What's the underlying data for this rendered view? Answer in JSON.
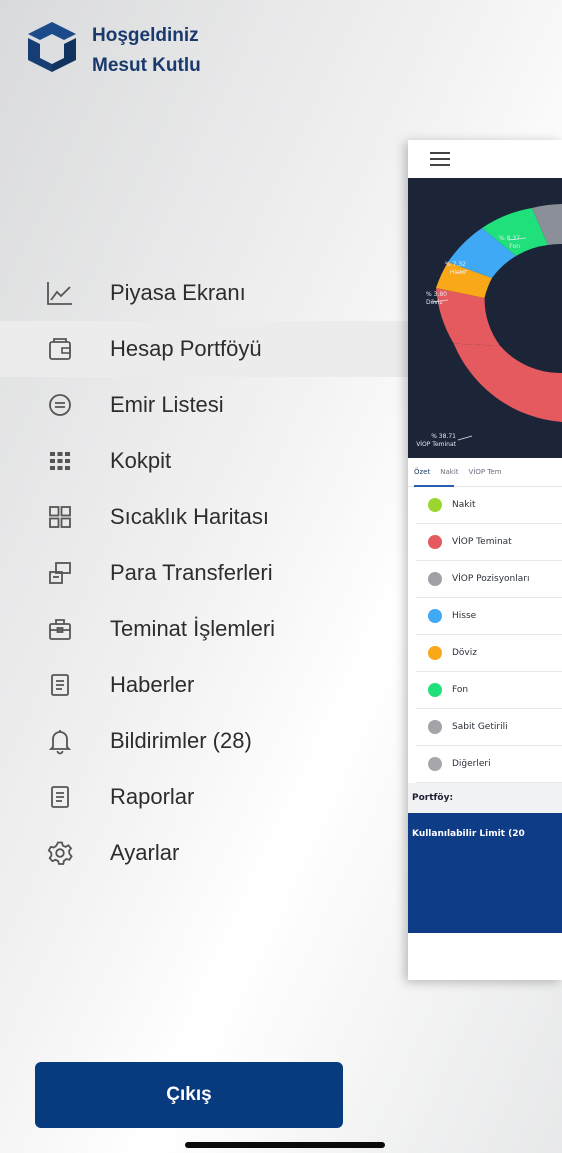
{
  "header": {
    "greeting": "Hoşgeldiniz",
    "user_name": "Mesut Kutlu"
  },
  "menu": {
    "items": [
      {
        "label": "Piyasa Ekranı",
        "icon": "chart-line-icon"
      },
      {
        "label": "Hesap Portföyü",
        "icon": "wallet-icon",
        "active": true
      },
      {
        "label": "Emir Listesi",
        "icon": "message-circle-icon"
      },
      {
        "label": "Kokpit",
        "icon": "grid-dots-icon"
      },
      {
        "label": "Sıcaklık Haritası",
        "icon": "grid-squares-icon"
      },
      {
        "label": "Para Transferleri",
        "icon": "transfer-icon"
      },
      {
        "label": "Teminat İşlemleri",
        "icon": "briefcase-icon"
      },
      {
        "label": "Haberler",
        "icon": "document-icon"
      },
      {
        "label": "Bildirimler (28)",
        "icon": "bell-icon"
      },
      {
        "label": "Raporlar",
        "icon": "report-icon"
      },
      {
        "label": "Ayarlar",
        "icon": "gear-icon"
      }
    ]
  },
  "exit_label": "Çıkış",
  "preview": {
    "chart_labels": [
      {
        "pct": "% 8.37",
        "name": "Fon"
      },
      {
        "pct": "% 7.32",
        "name": "Hisse"
      },
      {
        "pct": "% 3.80",
        "name": "Döviz"
      },
      {
        "pct": "% 38.71",
        "name": "VİOP Teminat"
      }
    ],
    "tabs": [
      "Özet",
      "Nakit",
      "VİOP Tem"
    ],
    "legend": [
      {
        "name": "Nakit",
        "color": "#9bd62e"
      },
      {
        "name": "VİOP Teminat",
        "color": "#e45a5f"
      },
      {
        "name": "VİOP Pozisyonları",
        "color": "#9fa1a6"
      },
      {
        "name": "Hisse",
        "color": "#3fa9f5"
      },
      {
        "name": "Döviz",
        "color": "#f9a817"
      },
      {
        "name": "Fon",
        "color": "#1fe07a"
      },
      {
        "name": "Sabit Getirili",
        "color": "#a2a4a8"
      },
      {
        "name": "Diğerleri",
        "color": "#a6a7ab"
      }
    ],
    "portfolio_label": "Portföy:",
    "limit_label": "Kullanılabilir Limit (20"
  }
}
